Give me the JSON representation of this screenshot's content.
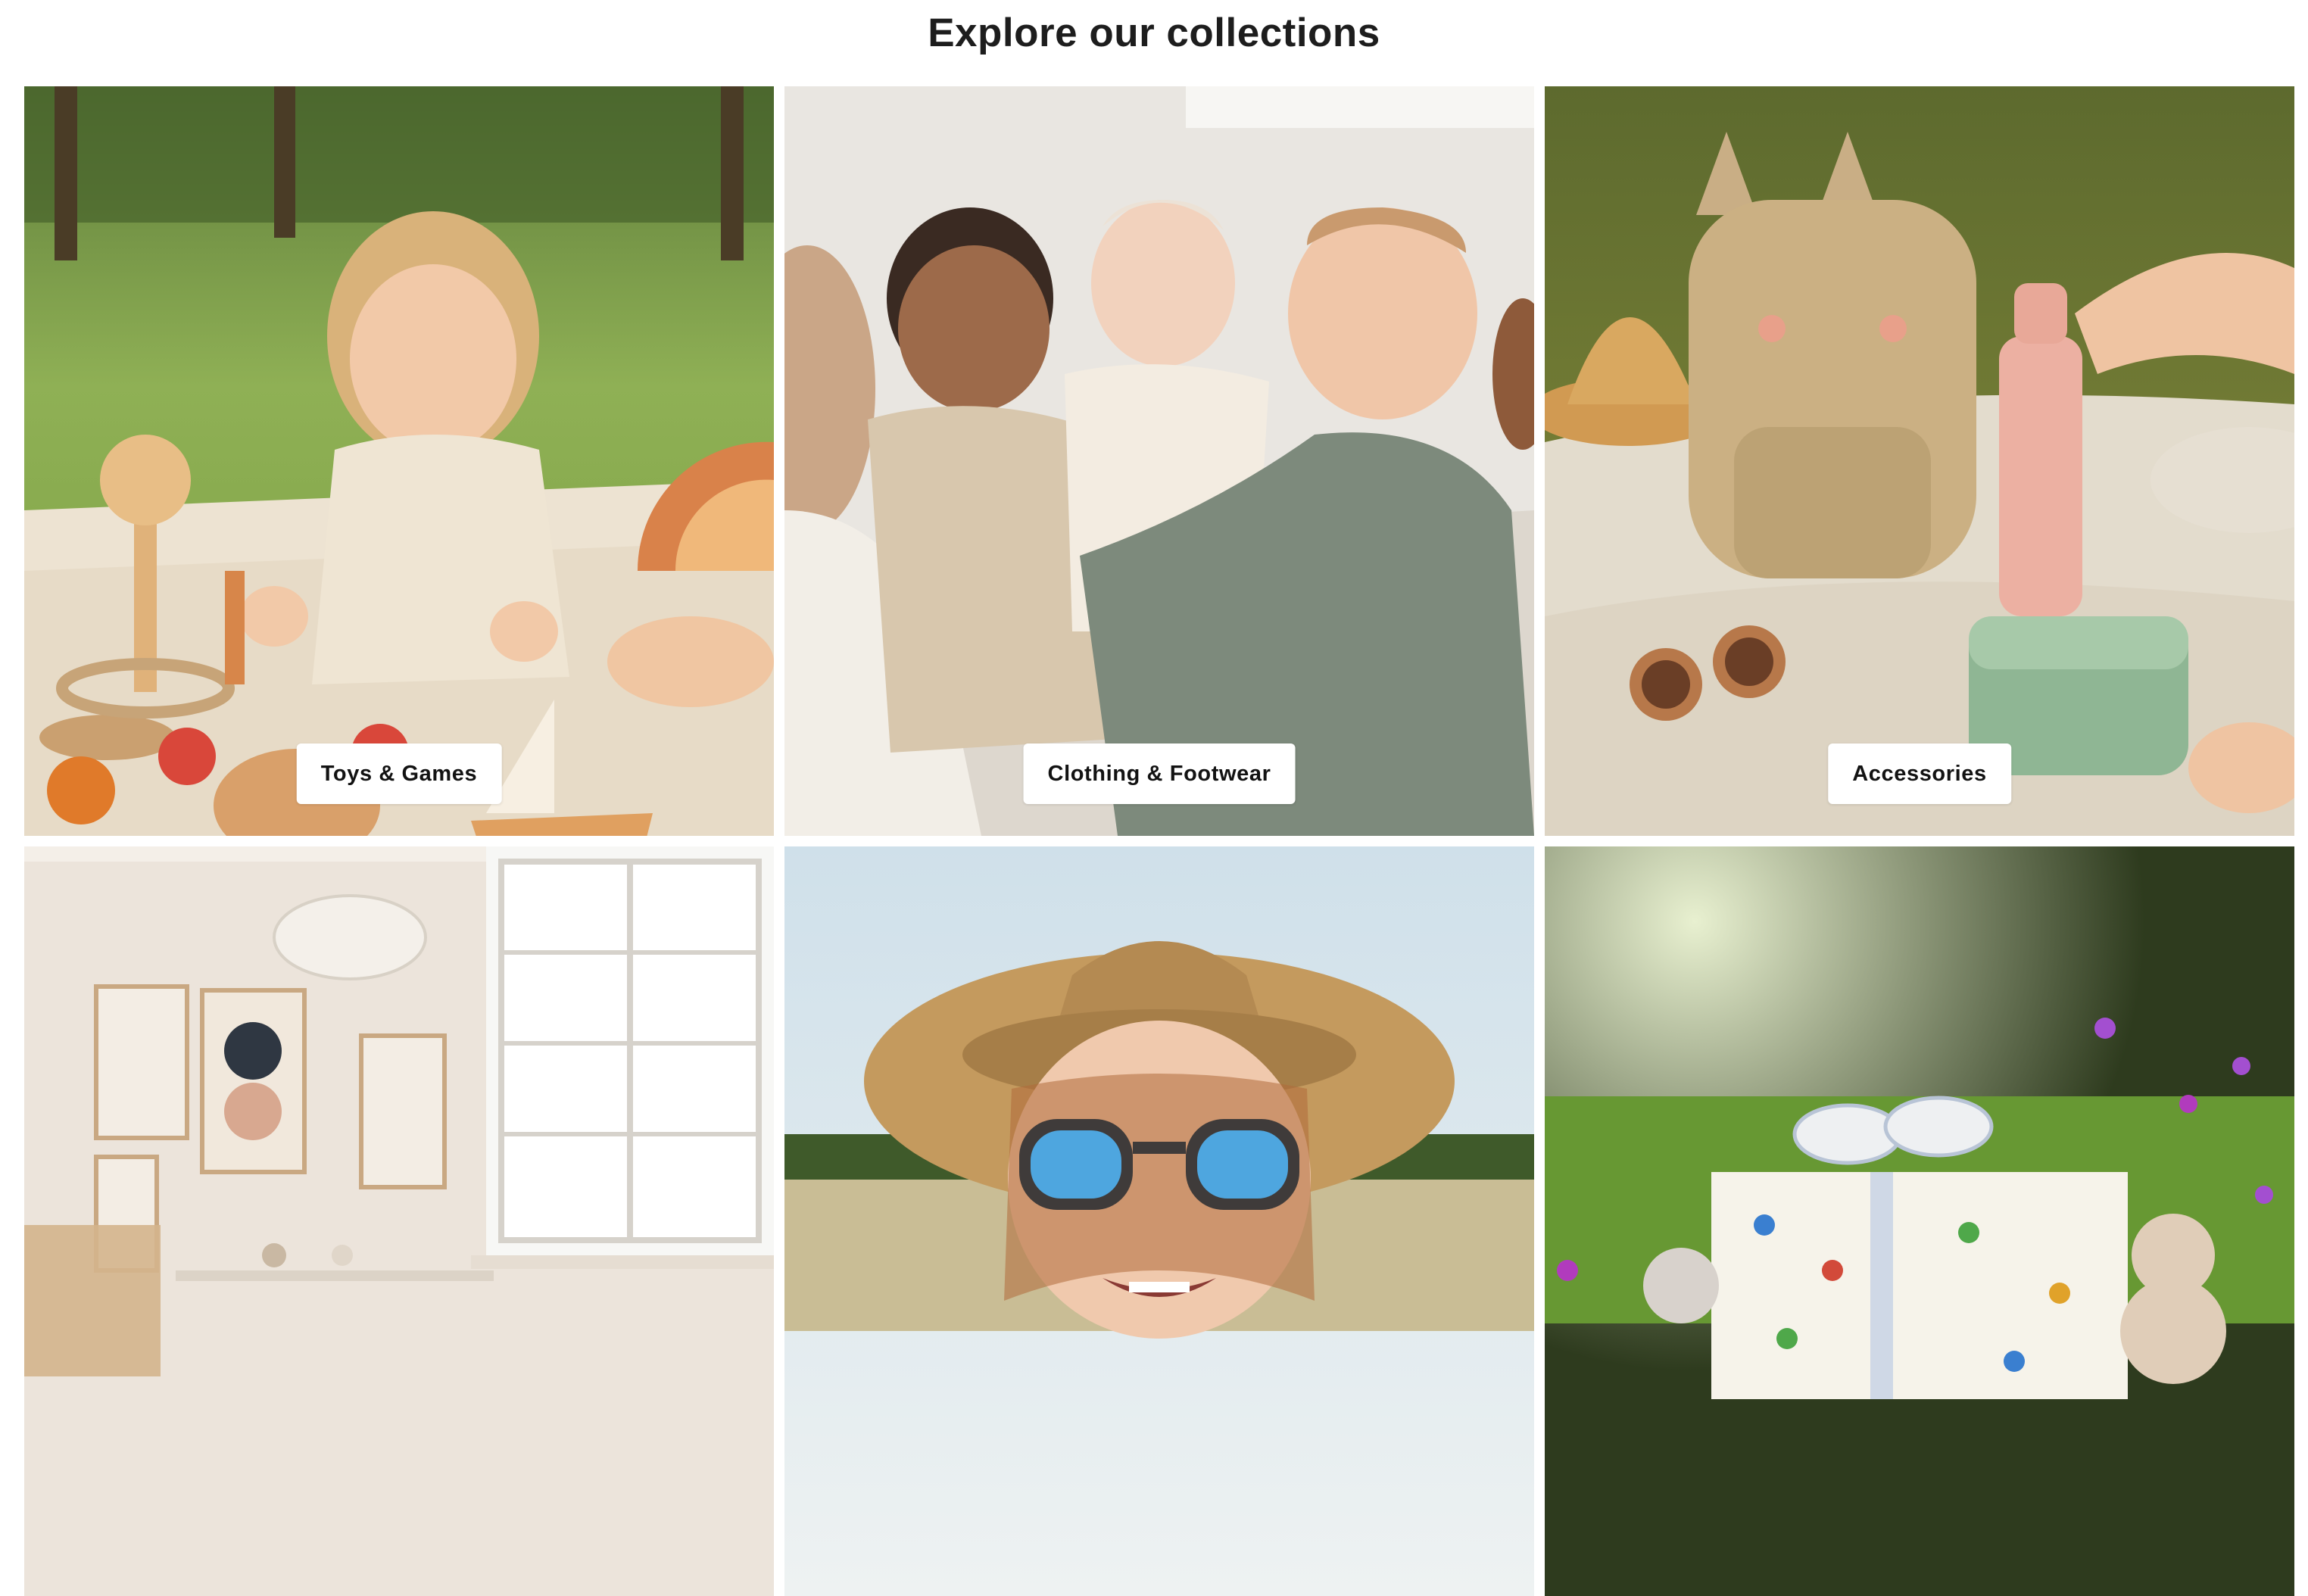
{
  "section": {
    "title": "Explore our collections"
  },
  "collections": [
    {
      "label": "Toys & Games",
      "image": "toddler-playing-wooden-toys-on-blanket"
    },
    {
      "label": "Clothing & Footwear",
      "image": "babies-sitting-together-smiling"
    },
    {
      "label": "Accessories",
      "image": "bunny-backpack-sunglasses-bottle-lunchbox"
    },
    {
      "label": "",
      "image": "nursery-room-with-window-and-art-prints"
    },
    {
      "label": "",
      "image": "child-in-straw-hat-and-sunglasses"
    },
    {
      "label": "",
      "image": "wrapped-gift-with-plush-toys-in-meadow"
    }
  ],
  "colors": {
    "label_bg": "#ffffff",
    "label_text": "#121212",
    "title_text": "#1d1d1d"
  }
}
